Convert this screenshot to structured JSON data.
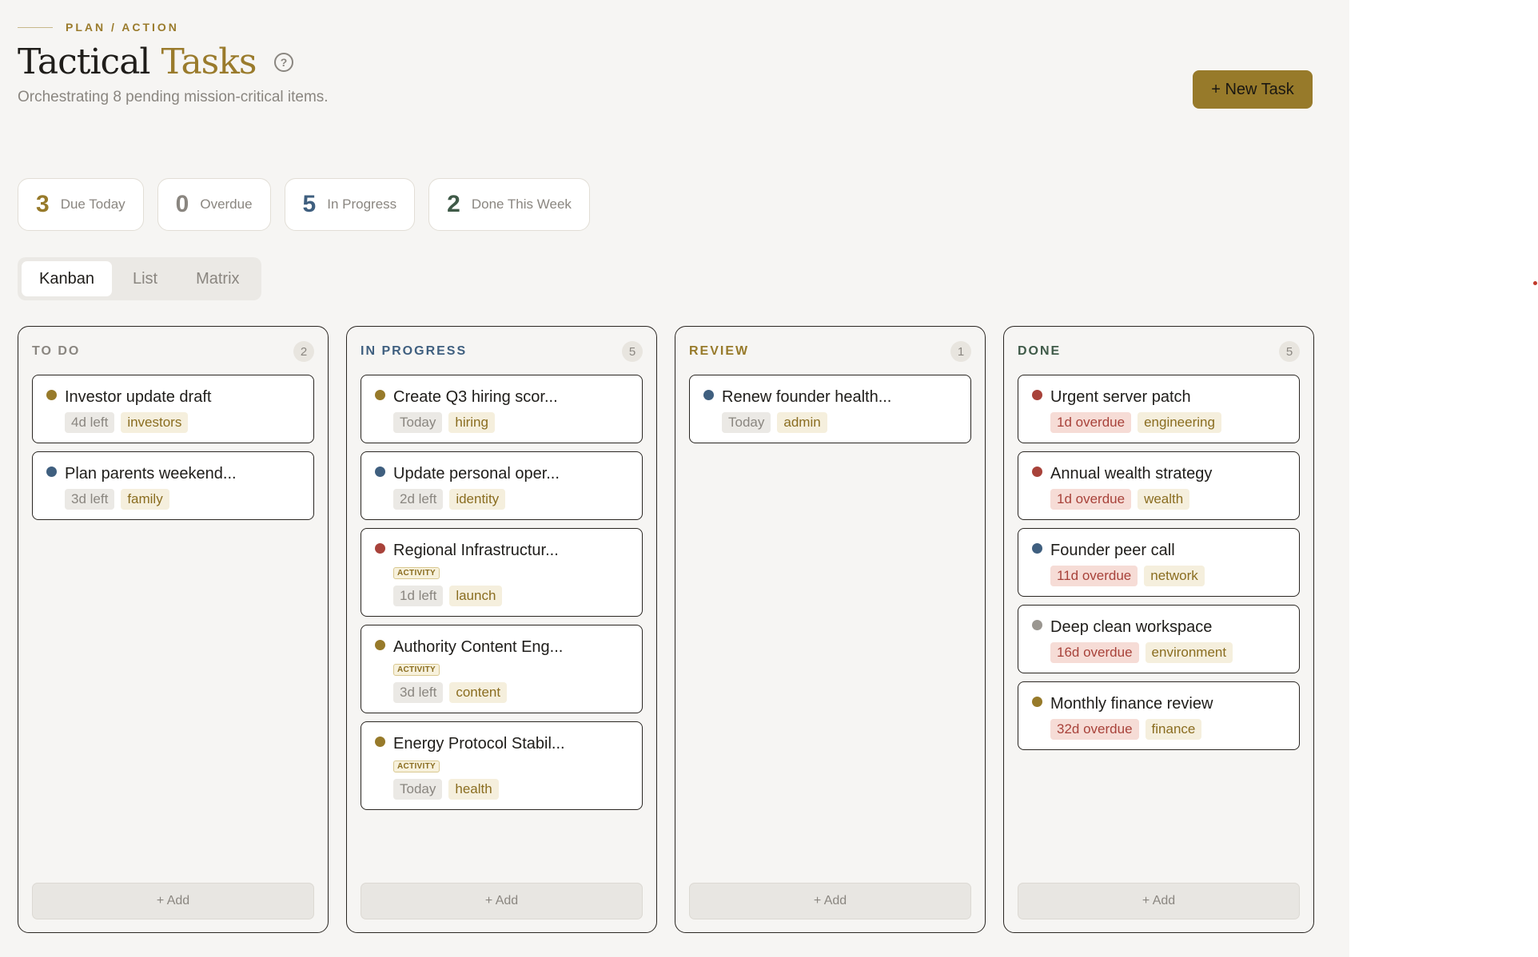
{
  "header": {
    "eyebrow": "PLAN / ACTION",
    "title_main": "Tactical",
    "title_accent": "Tasks",
    "help_glyph": "?",
    "subtitle": "Orchestrating 8 pending mission-critical items.",
    "new_task_label": "+ New Task"
  },
  "stats": [
    {
      "value": "3",
      "label": "Due Today",
      "color": "#977a2a"
    },
    {
      "value": "0",
      "label": "Overdue",
      "color": "#8a8680"
    },
    {
      "value": "5",
      "label": "In Progress",
      "color": "#3f5f7f"
    },
    {
      "value": "2",
      "label": "Done This Week",
      "color": "#3f5a48"
    }
  ],
  "views": {
    "tabs": [
      "Kanban",
      "List",
      "Matrix"
    ],
    "active": "Kanban"
  },
  "colors": {
    "accent": "#977a2a",
    "priority_high": "#a8423a",
    "priority_medium": "#977a2a",
    "priority_low": "#3f5f7f",
    "priority_none": "#9a9690"
  },
  "columns": [
    {
      "title": "TO DO",
      "count": "2",
      "color": "#8a8680",
      "add_label": "+ Add",
      "cards": [
        {
          "title": "Investor update draft",
          "dot": "#977a2a",
          "activity": "",
          "due": "4d left",
          "due_type": "due",
          "tag": "investors"
        },
        {
          "title": "Plan parents weekend...",
          "dot": "#3f5f7f",
          "activity": "",
          "due": "3d left",
          "due_type": "due",
          "tag": "family"
        }
      ]
    },
    {
      "title": "IN PROGRESS",
      "count": "5",
      "color": "#3f5f7f",
      "add_label": "+ Add",
      "cards": [
        {
          "title": "Create Q3 hiring scor...",
          "dot": "#977a2a",
          "activity": "",
          "due": "Today",
          "due_type": "due",
          "tag": "hiring"
        },
        {
          "title": "Update personal oper...",
          "dot": "#3f5f7f",
          "activity": "",
          "due": "2d left",
          "due_type": "due",
          "tag": "identity"
        },
        {
          "title": "Regional Infrastructur...",
          "dot": "#a8423a",
          "activity": "ACTIVITY",
          "due": "1d left",
          "due_type": "due",
          "tag": "launch"
        },
        {
          "title": "Authority Content Eng...",
          "dot": "#977a2a",
          "activity": "ACTIVITY",
          "due": "3d left",
          "due_type": "due",
          "tag": "content"
        },
        {
          "title": "Energy Protocol Stabil...",
          "dot": "#977a2a",
          "activity": "ACTIVITY",
          "due": "Today",
          "due_type": "due",
          "tag": "health"
        }
      ]
    },
    {
      "title": "REVIEW",
      "count": "1",
      "color": "#977a2a",
      "add_label": "+ Add",
      "cards": [
        {
          "title": "Renew founder health...",
          "dot": "#3f5f7f",
          "activity": "",
          "due": "Today",
          "due_type": "due",
          "tag": "admin"
        }
      ]
    },
    {
      "title": "DONE",
      "count": "5",
      "color": "#3f5a48",
      "add_label": "+ Add",
      "cards": [
        {
          "title": "Urgent server patch",
          "dot": "#a8423a",
          "activity": "",
          "due": "1d overdue",
          "due_type": "overdue",
          "tag": "engineering"
        },
        {
          "title": "Annual wealth strategy",
          "dot": "#a8423a",
          "activity": "",
          "due": "1d overdue",
          "due_type": "overdue",
          "tag": "wealth"
        },
        {
          "title": "Founder peer call",
          "dot": "#3f5f7f",
          "activity": "",
          "due": "11d overdue",
          "due_type": "overdue",
          "tag": "network"
        },
        {
          "title": "Deep clean workspace",
          "dot": "#9a9690",
          "activity": "",
          "due": "16d overdue",
          "due_type": "overdue",
          "tag": "environment"
        },
        {
          "title": "Monthly finance review",
          "dot": "#977a2a",
          "activity": "",
          "due": "32d overdue",
          "due_type": "overdue",
          "tag": "finance"
        }
      ]
    }
  ]
}
